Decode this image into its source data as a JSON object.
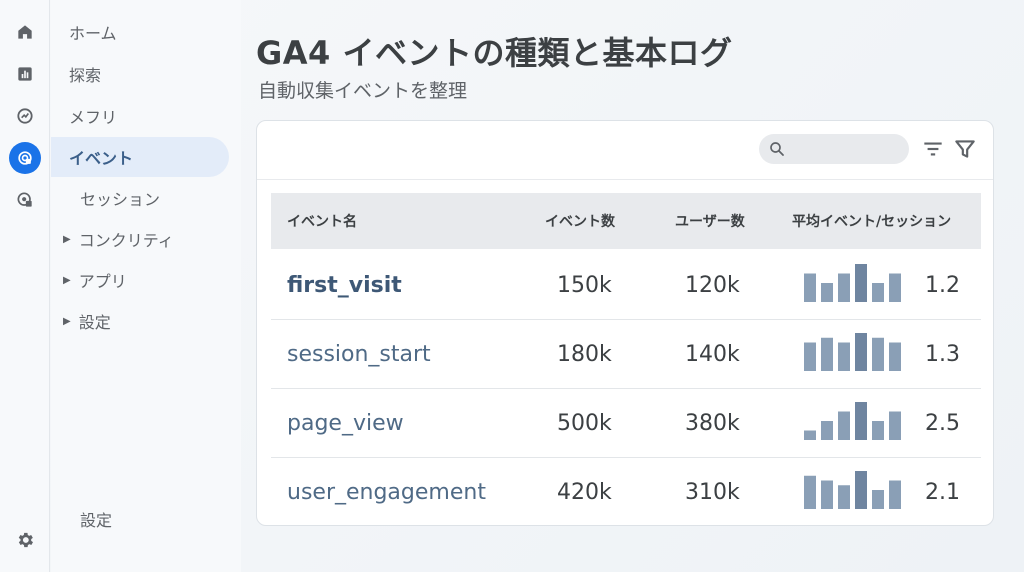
{
  "rail": {
    "icons": [
      "home-icon",
      "reports-icon",
      "explore-icon",
      "advertising-icon",
      "configure-icon"
    ],
    "settings_icon": "gear-icon"
  },
  "nav": {
    "items": [
      {
        "label": "ホーム"
      },
      {
        "label": "探索"
      },
      {
        "label": "メフリ"
      },
      {
        "label": "イベント"
      },
      {
        "label": "セッション"
      },
      {
        "label": "コンクリティ"
      },
      {
        "label": "アプリ"
      },
      {
        "label": "設定"
      }
    ],
    "active": "イベント",
    "footer_label": "設定"
  },
  "header": {
    "title": "GA4 イベントの種類と基本ログ",
    "subtitle": "自動収集イベントを整理"
  },
  "toolbar": {
    "search_placeholder": "",
    "icons": [
      "search-icon",
      "sort-icon",
      "filter-icon"
    ]
  },
  "table": {
    "columns": [
      "イベント名",
      "イベント数",
      "ユーザー数",
      "平均イベント/セッション"
    ],
    "rows": [
      {
        "name": "first_visit",
        "events": "150k",
        "users": "120k",
        "avg": "1.2",
        "spark": [
          3,
          2,
          3,
          4,
          2,
          3
        ]
      },
      {
        "name": "session_start",
        "events": "180k",
        "users": "140k",
        "avg": "1.3",
        "spark": [
          3,
          3.5,
          3,
          4,
          3.5,
          3
        ]
      },
      {
        "name": "page_view",
        "events": "500k",
        "users": "380k",
        "avg": "2.5",
        "spark": [
          1,
          2,
          3,
          4,
          2,
          3
        ]
      },
      {
        "name": "user_engagement",
        "events": "420k",
        "users": "310k",
        "avg": "2.1",
        "spark": [
          3.5,
          3,
          2.5,
          4,
          2,
          3
        ]
      }
    ]
  },
  "colors": {
    "accent": "#1a73e8",
    "active_nav_bg": "#e3ecf9",
    "spark_bar": "#8a9fb6",
    "spark_bar_peak": "#6f85a0"
  }
}
